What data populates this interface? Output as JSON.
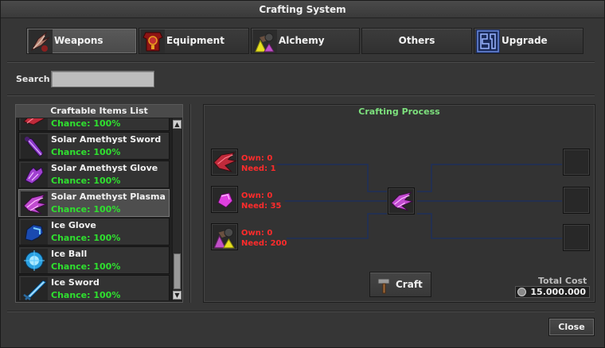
{
  "window": {
    "title": "Crafting System"
  },
  "tabs": [
    {
      "label": "Weapons",
      "icon": "weapon-claw-icon",
      "active": true
    },
    {
      "label": "Equipment",
      "icon": "armor-icon",
      "active": false
    },
    {
      "label": "Alchemy",
      "icon": "alchemy-flask-icon",
      "active": false
    },
    {
      "label": "Others",
      "icon": "",
      "active": false
    },
    {
      "label": "Upgrade",
      "icon": "upgrade-rune-icon",
      "active": false
    }
  ],
  "search": {
    "label": "Search",
    "value": "",
    "placeholder": ""
  },
  "list": {
    "header": "Craftable Items List",
    "items": [
      {
        "name": "",
        "chance": "Chance: 100%",
        "icon": "red-claw-icon"
      },
      {
        "name": "Solar Amethyst Sword",
        "chance": "Chance: 100%",
        "icon": "amethyst-sword-icon"
      },
      {
        "name": "Solar Amethyst Glove",
        "chance": "Chance: 100%",
        "icon": "amethyst-glove-icon"
      },
      {
        "name": "Solar Amethyst Plasma",
        "chance": "Chance: 100%",
        "icon": "amethyst-plasma-icon",
        "selected": true
      },
      {
        "name": "Ice Glove",
        "chance": "Chance: 100%",
        "icon": "ice-glove-icon"
      },
      {
        "name": "Ice Ball",
        "chance": "Chance: 100%",
        "icon": "ice-ball-icon"
      },
      {
        "name": "Ice Sword",
        "chance": "Chance: 100%",
        "icon": "ice-sword-icon"
      }
    ]
  },
  "process": {
    "title": "Crafting Process",
    "materials": [
      {
        "own": "Own: 0",
        "need": "Need: 1",
        "icon": "red-claw-icon"
      },
      {
        "own": "Own: 0",
        "need": "Need: 35",
        "icon": "pink-crystal-icon"
      },
      {
        "own": "Own: 0",
        "need": "Need: 200",
        "icon": "alchemy-flask-icon"
      }
    ],
    "result_icon": "amethyst-plasma-icon",
    "craft_label": "Craft",
    "total_cost_label": "Total Cost",
    "total_cost_value": "15.000.000"
  },
  "close_label": "Close",
  "colors": {
    "chance": "#2fe02f",
    "material_text": "#ff2b2b",
    "process_title": "#7de07d",
    "connector": "#1e2f5a"
  }
}
